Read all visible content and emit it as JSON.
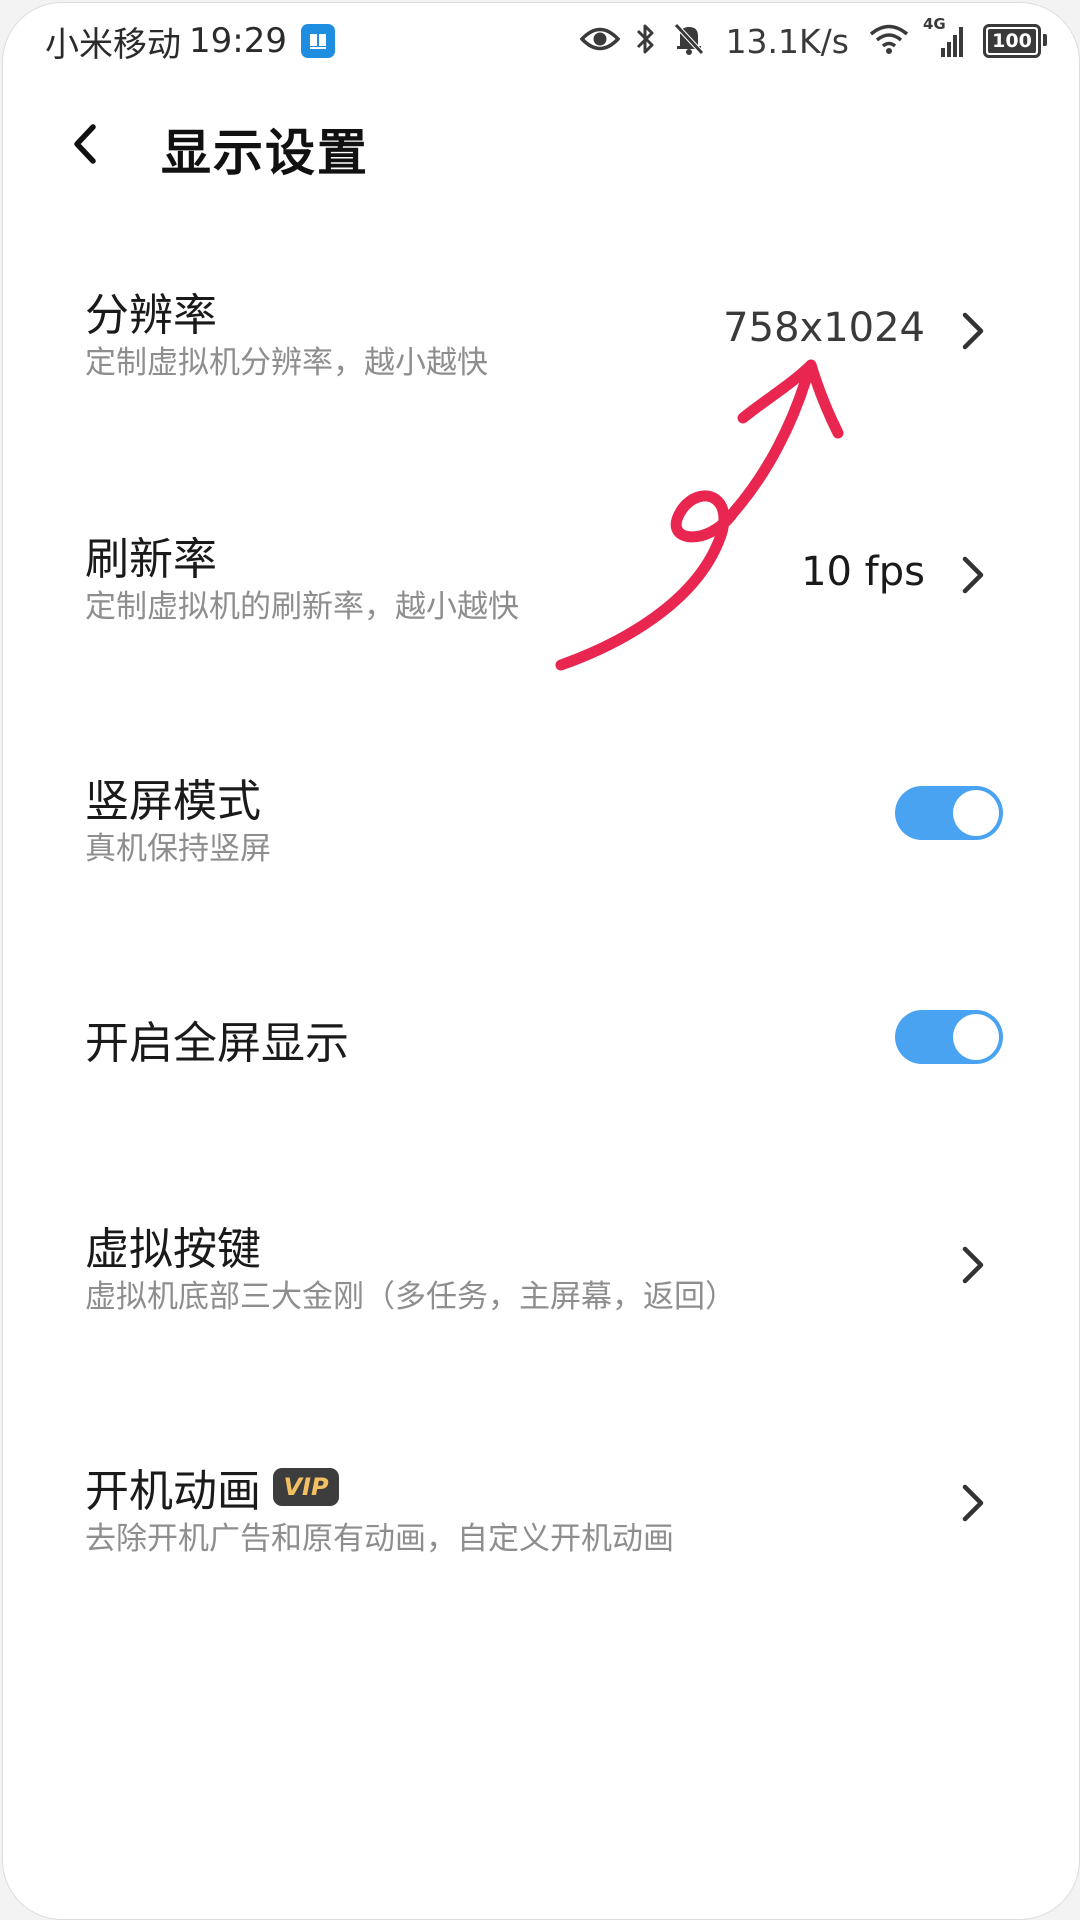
{
  "status_bar": {
    "carrier": "小米移动",
    "time": "19:29",
    "app_icon": "app-badge-icon",
    "icons": [
      "eye-icon",
      "bluetooth-icon",
      "bell-off-icon"
    ],
    "network_speed": "13.1K/s",
    "signal_label": "4G",
    "battery_level": "100"
  },
  "header": {
    "back_icon": "chevron-left-icon",
    "title": "显示设置"
  },
  "settings": {
    "resolution": {
      "title": "分辨率",
      "subtitle": "定制虚拟机分辨率，越小越快",
      "value": "758x1024"
    },
    "refresh_rate": {
      "title": "刷新率",
      "subtitle": "定制虚拟机的刷新率，越小越快",
      "value": "10 fps"
    },
    "portrait_mode": {
      "title": "竖屏模式",
      "subtitle": "真机保持竖屏",
      "enabled": true
    },
    "fullscreen": {
      "title": "开启全屏显示",
      "enabled": true
    },
    "virtual_keys": {
      "title": "虚拟按键",
      "subtitle": "虚拟机底部三大金刚（多任务，主屏幕，返回）"
    },
    "boot_animation": {
      "title": "开机动画",
      "badge": "VIP",
      "subtitle": "去除开机广告和原有动画，自定义开机动画"
    }
  },
  "colors": {
    "toggle_on": "#4aa3f0",
    "annotation_arrow": "#e8264f",
    "vip_text": "#f2c062"
  }
}
